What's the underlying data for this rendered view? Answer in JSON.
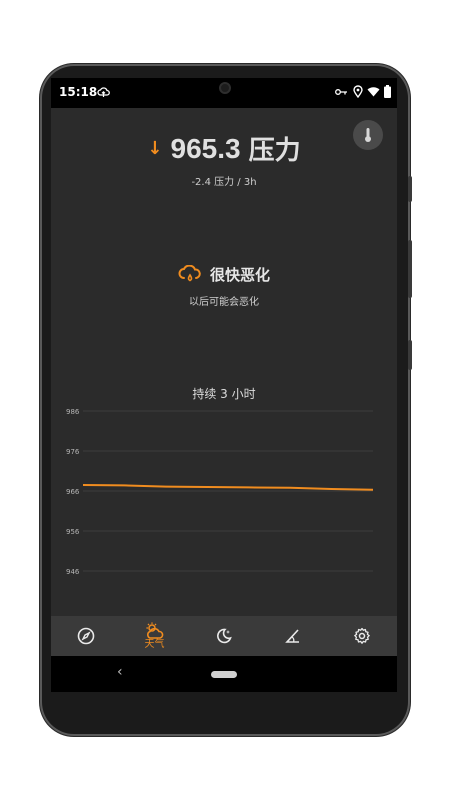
{
  "status_bar": {
    "time": "15:18",
    "icons": [
      "cloud-upload-icon",
      "key-icon",
      "location-icon",
      "wifi-icon",
      "battery-icon"
    ]
  },
  "header": {
    "pressure_value": "965.3",
    "pressure_unit": "压力",
    "trend_arrow": "↓",
    "change_text": "-2.4 压力 / 3h"
  },
  "forecast": {
    "title": "很快恶化",
    "subtitle": "以后可能会恶化"
  },
  "duration_label": "持续 3 小时",
  "colors": {
    "accent": "#f08c1f",
    "background": "#2b2b2b",
    "nav_background": "#3a3a3a"
  },
  "chart_data": {
    "type": "line",
    "ylim": [
      946,
      986
    ],
    "y_ticks": [
      986,
      976,
      966,
      956,
      946
    ],
    "series": [
      {
        "values": [
          967.5,
          967.4,
          967.1,
          967.0,
          966.9,
          966.8,
          966.5,
          966.3
        ]
      }
    ],
    "grid": true
  },
  "navbar": {
    "items": [
      {
        "icon": "compass-icon",
        "label": ""
      },
      {
        "icon": "weather-icon",
        "label": "天气",
        "active": true
      },
      {
        "icon": "moon-icon",
        "label": ""
      },
      {
        "icon": "angle-icon",
        "label": ""
      },
      {
        "icon": "gear-icon",
        "label": ""
      }
    ]
  },
  "system_nav": {
    "back": "‹"
  }
}
